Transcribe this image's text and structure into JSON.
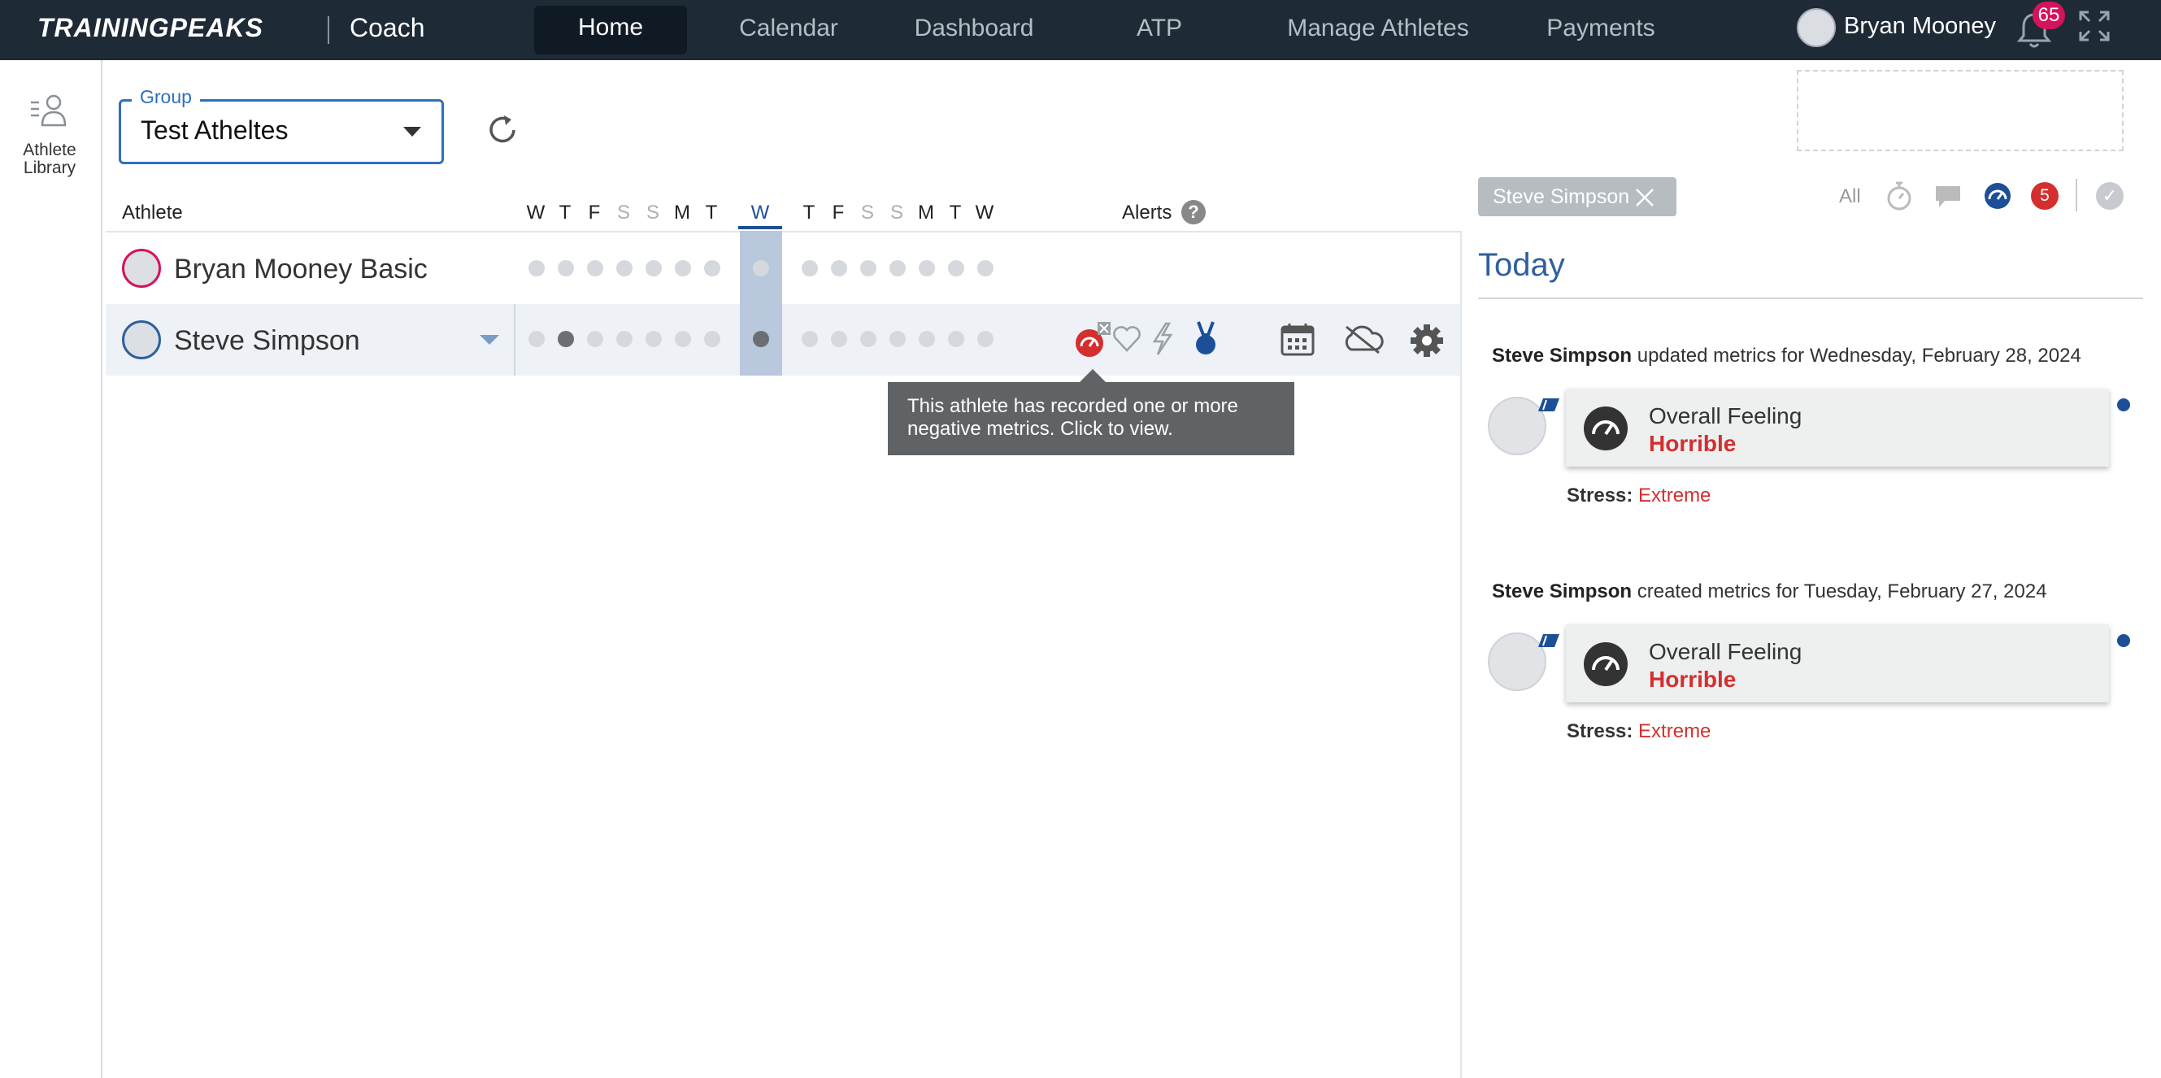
{
  "topbar": {
    "brand": "TRAININGPEAKS",
    "product": "Coach",
    "nav": [
      "Home",
      "Calendar",
      "Dashboard",
      "ATP",
      "Manage Athletes",
      "Payments"
    ],
    "active_nav": "Home",
    "user_name": "Bryan Mooney",
    "notification_count": "65"
  },
  "sidebar": {
    "athlete_library_label": "Athlete Library"
  },
  "group_select": {
    "legend": "Group",
    "value": "Test Atheltes"
  },
  "table": {
    "athlete_header": "Athlete",
    "alerts_header": "Alerts",
    "help": "?",
    "days": [
      "W",
      "T",
      "F",
      "S",
      "S",
      "M",
      "T",
      "W",
      "T",
      "F",
      "S",
      "S",
      "M",
      "T",
      "W"
    ],
    "athletes": [
      {
        "name": "Bryan Mooney Basic"
      },
      {
        "name": "Steve Simpson"
      }
    ]
  },
  "tooltip": {
    "text": "This athlete has recorded one or more negative metrics. Click to view."
  },
  "activity_panel": {
    "filter_chip": "Steve Simpson",
    "filter_all": "All",
    "metrics_badge": "5",
    "check": "✓",
    "heading": "Today",
    "items": [
      {
        "athlete": "Steve Simpson",
        "action": "updated metrics for Wednesday, February 28, 2024",
        "metric_label": "Overall Feeling",
        "metric_value": "Horrible",
        "stress_label": "Stress:",
        "stress_value": "Extreme"
      },
      {
        "athlete": "Steve Simpson",
        "action": "created metrics for Tuesday, February 27, 2024",
        "metric_label": "Overall Feeling",
        "metric_value": "Horrible",
        "stress_label": "Stress:",
        "stress_value": "Extreme"
      }
    ]
  },
  "colors": {
    "topbar": "#1e2a36",
    "accent_blue": "#2f5f9e",
    "alert_red": "#d32f2f",
    "badge_pink": "#d4145a"
  }
}
